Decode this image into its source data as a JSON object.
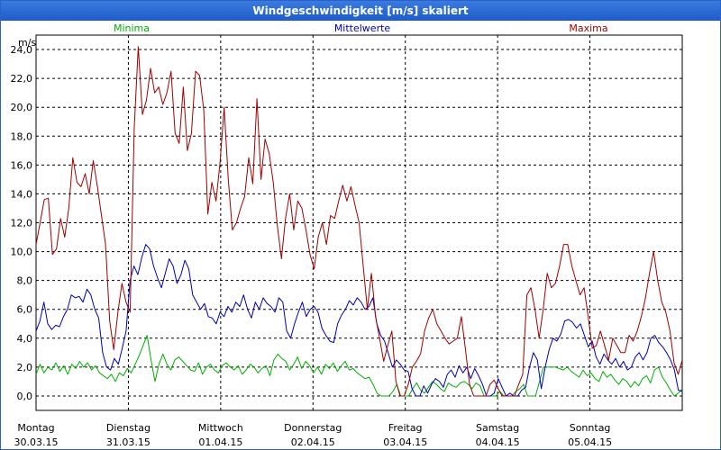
{
  "window": {
    "title": "Windgeschwindigkeit [m/s] skaliert"
  },
  "colors": {
    "minima": "#00b000",
    "mittel": "#0000b4",
    "maxima": "#a00000",
    "grid": "#000000",
    "frame": "#2a62c9"
  },
  "chart_data": {
    "type": "line",
    "title": "Windgeschwindigkeit [m/s] skaliert",
    "ylabel": "m/s",
    "ylim": [
      -1.0,
      25.0
    ],
    "yticks": [
      0,
      2,
      4,
      6,
      8,
      10,
      12,
      14,
      16,
      18,
      20,
      22,
      24
    ],
    "ytick_labels": [
      "0,0",
      "2,0",
      "4,0",
      "6,0",
      "8,0",
      "10,0",
      "12,0",
      "14,0",
      "16,0",
      "18,0",
      "20,0",
      "22,0",
      "24,0"
    ],
    "grid": true,
    "legend_placement": "top",
    "x_days": [
      {
        "day": "Montag",
        "date": "30.03.15"
      },
      {
        "day": "Dienstag",
        "date": "31.03.15"
      },
      {
        "day": "Mittwoch",
        "date": "01.04.15"
      },
      {
        "day": "Donnerstag",
        "date": "02.04.15"
      },
      {
        "day": "Freitag",
        "date": "03.04.15"
      },
      {
        "day": "Samstag",
        "date": "04.04.15"
      },
      {
        "day": "Sonntag",
        "date": "05.04.15"
      }
    ],
    "series": [
      {
        "name": "Minima",
        "color": "#00b000",
        "values": [
          1.5,
          2.2,
          1.6,
          2.0,
          1.8,
          2.3,
          1.7,
          2.1,
          1.5,
          2.2,
          1.9,
          2.4,
          2.0,
          2.3,
          1.8,
          2.1,
          1.6,
          1.4,
          1.2,
          1.5,
          1.0,
          1.6,
          1.4,
          1.9,
          1.6,
          2.2,
          2.8,
          3.5,
          4.2,
          2.5,
          1.0,
          2.2,
          2.9,
          2.2,
          1.8,
          2.5,
          2.7,
          2.4,
          2.1,
          1.8,
          1.7,
          2.3,
          1.5,
          2.0,
          2.2,
          1.8,
          1.6,
          2.1,
          2.3,
          2.0,
          1.8,
          2.1,
          1.5,
          1.8,
          2.2,
          2.0,
          1.6,
          1.9,
          2.1,
          1.4,
          2.5,
          2.9,
          2.6,
          2.4,
          1.8,
          2.2,
          2.7,
          1.9,
          2.4,
          2.1,
          1.6,
          2.0,
          1.5,
          2.2,
          1.9,
          2.3,
          1.7,
          2.1,
          2.4,
          1.8,
          1.9,
          1.6,
          1.4,
          1.2,
          1.3,
          0.8,
          0.2,
          0.0,
          0.0,
          0.0,
          0.3,
          0.8,
          0.0,
          0.0,
          0.0,
          0.5,
          0.9,
          0.4,
          0.2,
          0.6,
          1.0,
          0.8,
          0.5,
          0.3,
          0.9,
          0.7,
          0.6,
          0.9,
          1.0,
          0.8,
          0.5,
          0.9,
          0.7,
          0.0,
          0.0,
          0.0,
          0.0,
          0.3,
          0.0,
          0.0,
          0.0,
          0.3,
          0.5,
          0.8,
          0.0,
          0.0,
          0.0,
          1.0,
          2.0,
          2.0,
          2.0,
          2.0,
          1.9,
          1.8,
          2.0,
          1.7,
          1.5,
          1.3,
          1.8,
          1.4,
          1.6,
          1.2,
          1.0,
          1.7,
          1.3,
          1.5,
          1.1,
          0.8,
          1.2,
          1.0,
          0.6,
          1.0,
          0.7,
          1.2,
          1.4,
          0.9,
          1.8,
          2.0,
          1.3,
          0.9,
          0.4,
          0.0,
          0.2,
          0.5
        ]
      },
      {
        "name": "Mittelwerte",
        "color": "#0000b4",
        "values": [
          4.5,
          5.2,
          6.5,
          5.0,
          4.6,
          4.9,
          4.8,
          5.5,
          6.0,
          7.0,
          6.8,
          6.9,
          6.5,
          7.4,
          7.0,
          6.0,
          5.4,
          3.0,
          2.0,
          1.8,
          2.6,
          2.2,
          3.3,
          4.5,
          8.0,
          9.0,
          8.4,
          9.6,
          10.5,
          10.2,
          9.0,
          8.2,
          7.5,
          8.5,
          9.5,
          9.0,
          7.8,
          8.4,
          9.4,
          8.8,
          7.0,
          6.5,
          6.0,
          6.4,
          5.5,
          5.4,
          5.0,
          5.8,
          5.5,
          6.2,
          5.8,
          6.5,
          6.2,
          7.0,
          6.0,
          5.4,
          6.5,
          6.0,
          6.8,
          6.4,
          6.2,
          5.8,
          6.8,
          6.5,
          4.5,
          4.0,
          5.0,
          5.8,
          6.5,
          5.5,
          6.0,
          6.2,
          5.8,
          4.7,
          4.2,
          3.8,
          3.7,
          5.0,
          5.6,
          6.0,
          6.6,
          6.3,
          6.8,
          6.5,
          6.0,
          6.2,
          6.8,
          5.0,
          4.2,
          3.8,
          2.9,
          2.0,
          2.5,
          2.2,
          1.8,
          1.7,
          0.5,
          0.0,
          0.0,
          0.7,
          0.2,
          0.8,
          1.2,
          1.0,
          0.6,
          1.5,
          1.8,
          1.3,
          2.1,
          1.6,
          2.0,
          1.2,
          1.9,
          1.4,
          0.8,
          0.0,
          0.0,
          0.2,
          1.2,
          0.6,
          0.0,
          0.2,
          0.0,
          0.0,
          0.4,
          0.6,
          2.0,
          3.0,
          2.5,
          0.5,
          2.0,
          3.2,
          4.0,
          3.8,
          4.3,
          5.2,
          5.3,
          5.1,
          4.7,
          5.0,
          4.2,
          3.4,
          3.8,
          2.7,
          2.2,
          2.9,
          2.5,
          2.2,
          2.6,
          2.0,
          2.4,
          1.8,
          2.0,
          2.7,
          3.0,
          2.5,
          3.0,
          4.0,
          4.2,
          3.7,
          3.4,
          3.0,
          2.5,
          1.8,
          0.4,
          0.3
        ]
      },
      {
        "name": "Maxima",
        "color": "#a00000",
        "values": [
          10.5,
          12.0,
          13.6,
          13.7,
          9.8,
          10.2,
          12.3,
          11.0,
          13.0,
          16.5,
          14.8,
          14.5,
          15.4,
          14.0,
          16.3,
          14.5,
          12.5,
          10.5,
          5.2,
          3.2,
          5.8,
          7.8,
          6.5,
          5.8,
          18.5,
          24.2,
          19.5,
          20.5,
          22.7,
          21.0,
          21.4,
          20.2,
          21.0,
          22.5,
          18.2,
          17.5,
          21.4,
          17.0,
          18.2,
          22.5,
          22.2,
          19.8,
          12.6,
          14.8,
          13.5,
          16.2,
          20.0,
          15.0,
          11.5,
          12.0,
          13.0,
          13.8,
          16.5,
          14.7,
          20.6,
          15.0,
          17.8,
          16.8,
          14.8,
          11.8,
          9.5,
          12.3,
          14.0,
          11.5,
          13.5,
          13.0,
          11.5,
          9.8,
          8.8,
          11.0,
          12.0,
          10.5,
          12.5,
          12.3,
          13.5,
          14.6,
          13.5,
          14.5,
          13.2,
          12.0,
          9.0,
          6.0,
          8.5,
          5.5,
          4.0,
          2.4,
          3.5,
          4.5,
          1.0,
          0.0,
          0.0,
          0.8,
          2.0,
          2.4,
          2.9,
          4.5,
          5.4,
          6.0,
          5.0,
          4.5,
          4.0,
          3.6,
          3.8,
          4.0,
          5.5,
          3.2,
          0.8,
          0.0,
          0.0,
          0.0,
          0.0,
          0.8,
          1.1,
          0.5,
          0.0,
          0.0,
          0.0,
          0.0,
          0.8,
          1.5,
          7.0,
          7.5,
          6.0,
          4.0,
          6.0,
          8.5,
          7.5,
          7.8,
          9.0,
          10.5,
          10.5,
          9.0,
          8.0,
          7.0,
          7.5,
          5.5,
          3.3,
          3.5,
          4.5,
          3.5,
          2.5,
          4.0,
          3.5,
          3.0,
          3.0,
          4.2,
          3.8,
          4.5,
          5.5,
          6.8,
          8.5,
          10.0,
          8.0,
          6.5,
          5.8,
          4.5,
          2.3,
          1.5,
          2.5
        ]
      }
    ]
  }
}
